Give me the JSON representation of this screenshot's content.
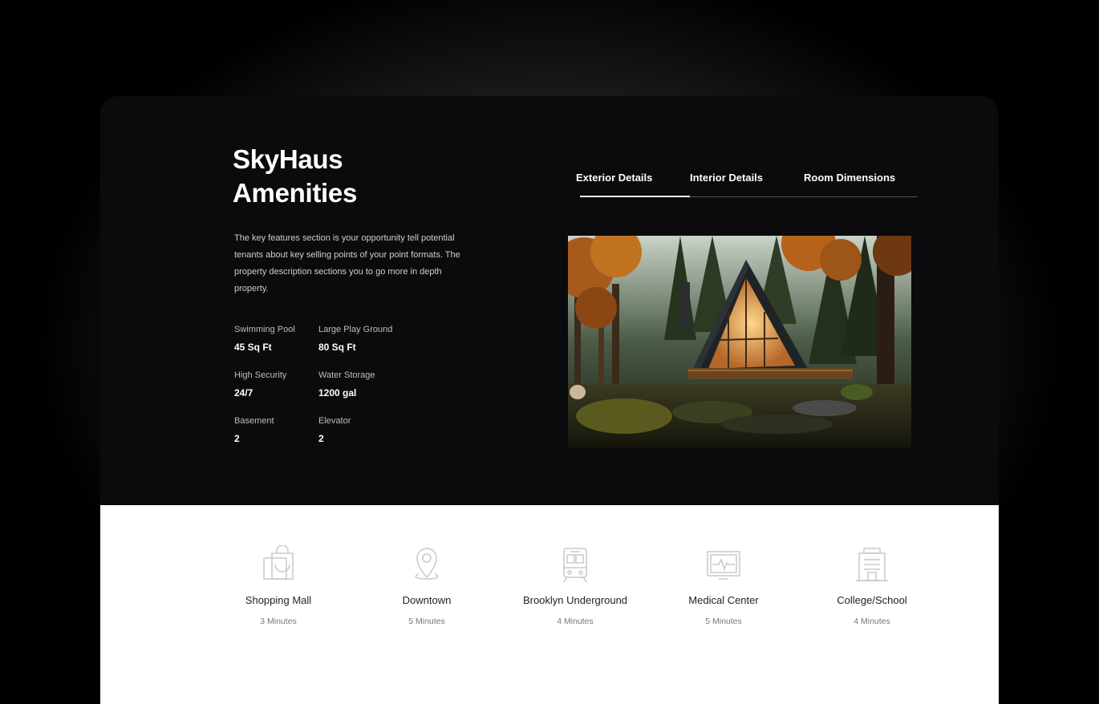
{
  "hero": {
    "title_line1": "SkyHaus",
    "title_line2": "Amenities",
    "description": "The key features section is your opportunity tell potential tenants about key selling points of your point formats. The property description sections you to go more in depth property."
  },
  "stats": [
    {
      "label": "Swimming Pool",
      "value": "45 Sq Ft"
    },
    {
      "label": "Large Play Ground",
      "value": "80 Sq Ft"
    },
    {
      "label": "High Security",
      "value": "24/7"
    },
    {
      "label": "Water Storage",
      "value": "1200 gal"
    },
    {
      "label": "Basement",
      "value": "2"
    },
    {
      "label": "Elevator",
      "value": "2"
    }
  ],
  "tabs": [
    {
      "label": "Exterior Details",
      "active": true
    },
    {
      "label": "Interior Details",
      "active": false
    },
    {
      "label": "Room Dimensions",
      "active": false
    }
  ],
  "photo": {
    "icon": "a-frame-cabin-forest-photo"
  },
  "locations": [
    {
      "name": "Shopping Mall",
      "time": "3 Minutes",
      "icon": "shopping-bag-icon"
    },
    {
      "name": "Downtown",
      "time": "5 Minutes",
      "icon": "map-pin-icon"
    },
    {
      "name": "Brooklyn Underground",
      "time": "4 Minutes",
      "icon": "train-icon"
    },
    {
      "name": "Medical Center",
      "time": "5 Minutes",
      "icon": "heart-monitor-icon"
    },
    {
      "name": "College/School",
      "time": "4 Minutes",
      "icon": "building-icon"
    }
  ],
  "colors": {
    "dark_bg": "#0b0a0d",
    "light_bg": "#ffffff",
    "accent": "#ffffff",
    "icon_stroke": "#c8c8c8"
  }
}
